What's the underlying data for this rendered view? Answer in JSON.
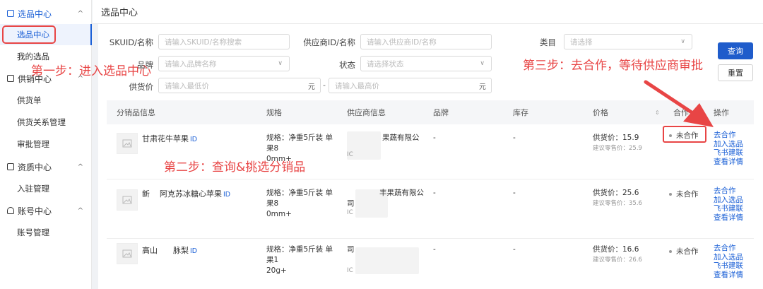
{
  "sidebar": {
    "groups": [
      {
        "label": "选品中心",
        "items": [
          "选品中心",
          "我的选品"
        ]
      },
      {
        "label": "供销中心",
        "items": [
          "供货单",
          "供货关系管理",
          "审批管理"
        ]
      },
      {
        "label": "资质中心",
        "items": [
          "入驻管理"
        ]
      },
      {
        "label": "账号中心",
        "items": [
          "账号管理"
        ]
      }
    ]
  },
  "header": {
    "title": "选品中心"
  },
  "filters": {
    "skuid_label": "SKUID/名称",
    "skuid_placeholder": "请输入SKUID/名称搜索",
    "supplier_label": "供应商ID/名称",
    "supplier_placeholder": "请输入供应商ID/名称",
    "category_label": "类目",
    "category_placeholder": "请选择",
    "brand_label": "品牌",
    "brand_placeholder": "请输入品牌名称",
    "status_label": "状态",
    "status_placeholder": "请选择状态",
    "price_label": "供货价",
    "price_min_placeholder": "请输入最低价",
    "price_max_placeholder": "请输入最高价",
    "price_unit": "元",
    "range_dash": "-"
  },
  "buttons": {
    "query": "查询",
    "reset": "重置"
  },
  "table": {
    "columns": [
      "分销品信息",
      "规格",
      "供应商信息",
      "品牌",
      "库存",
      "价格",
      "合作",
      "操作"
    ],
    "rows": [
      {
        "name_prefix": "甘肃花牛苹果",
        "name_suffix": "",
        "id_badge": "ID",
        "spec_line1": "规格：净重5斤装 单果8",
        "spec_line2": "0mm+",
        "supplier_line1": "果蔬有限公",
        "supplier_line2": "",
        "supplier_id": "IC",
        "brand": "-",
        "stock": "-",
        "price": "供货价：15.9",
        "suggest": "建议零售价：25.9",
        "status": "未合作",
        "actions": [
          "去合作",
          "加入选品",
          "飞书建联",
          "查看详情"
        ]
      },
      {
        "name_prefix": "新",
        "name_suffix": "阿克苏冰糖心苹果",
        "id_badge": "ID",
        "spec_line1": "规格：净重5斤装 单果8",
        "spec_line2": "0mm+",
        "supplier_line1": "丰果蔬有限公",
        "supplier_line2": "司",
        "supplier_id": "IC",
        "brand": "-",
        "stock": "-",
        "price": "供货价：25.6",
        "suggest": "建议零售价：35.6",
        "status": "未合作",
        "actions": [
          "去合作",
          "加入选品",
          "飞书建联",
          "查看详情"
        ]
      },
      {
        "name_prefix": "高山",
        "name_suffix": "脉梨",
        "id_badge": "ID",
        "spec_line1": "规格：净重5斤装 单果1",
        "spec_line2": "20g+",
        "supplier_line1": "",
        "supplier_line2": "司",
        "supplier_id": "IC",
        "brand": "-",
        "stock": "-",
        "price": "供货价：16.6",
        "suggest": "建议零售价：26.6",
        "status": "未合作",
        "actions": [
          "去合作",
          "加入选品",
          "飞书建联",
          "查看详情"
        ]
      }
    ]
  },
  "annotations": {
    "step1": "第一步：进入选品中心",
    "step2": "第二步：查询&挑选分销品",
    "step3": "第三步：去合作，等待供应商审批"
  },
  "colors": {
    "accent": "#1a5fd6",
    "annotation": "#e84545",
    "primary_button": "#1f5ccb"
  }
}
